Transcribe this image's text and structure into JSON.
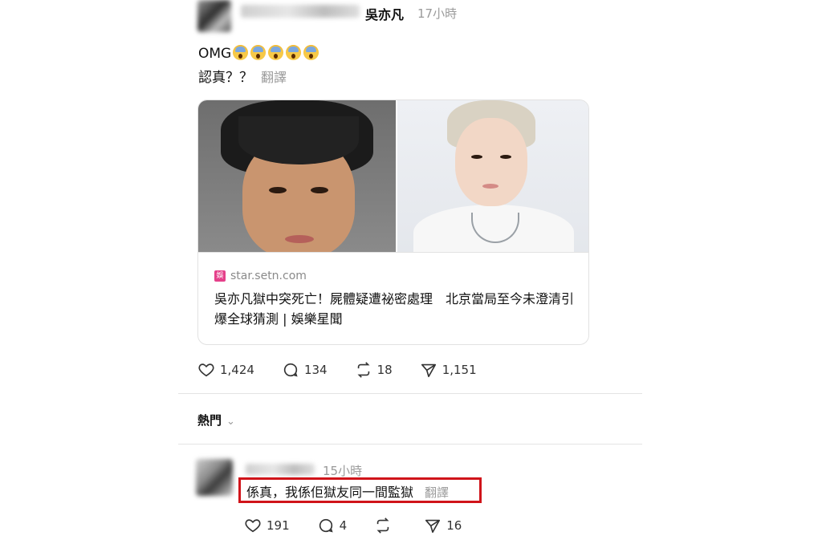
{
  "post": {
    "author": "吳亦凡",
    "time": "17小時",
    "line1": "OMG",
    "emoji_count": 5,
    "line2": "認真？？",
    "translate": "翻譯"
  },
  "link_card": {
    "domain": "star.setn.com",
    "favicon_letter": "娛",
    "title": "吳亦凡獄中突死亡！屍體疑遭祕密處理　北京當局至今未澄清引爆全球猜測 | 娛樂星聞"
  },
  "post_actions": {
    "likes": "1,424",
    "comments": "134",
    "reposts": "18",
    "shares": "1,151"
  },
  "sort": {
    "label": "熱門",
    "chevron": "⌄"
  },
  "reply": {
    "time": "15小時",
    "text": "係真，我係佢獄友同一間監獄",
    "translate": "翻譯",
    "likes": "191",
    "comments": "4",
    "reposts": "",
    "shares": "16"
  },
  "colors": {
    "highlight_border": "#d0141a",
    "muted_text": "#9a9a9a",
    "favicon": "#e5408a"
  }
}
